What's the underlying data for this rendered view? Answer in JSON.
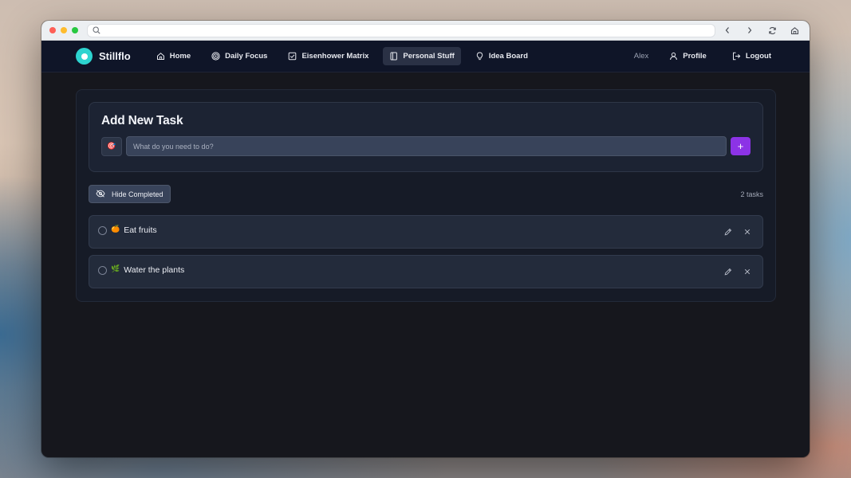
{
  "browser": {
    "url": "",
    "buttons": {
      "back": "chevron-left-icon",
      "forward": "chevron-right-icon",
      "reload": "reload-icon",
      "home": "home-icon"
    }
  },
  "brand": {
    "name": "Stillflo",
    "color": "#2dd4d0"
  },
  "nav": {
    "items": [
      {
        "label": "Home",
        "icon": "home-icon"
      },
      {
        "label": "Daily Focus",
        "icon": "target-icon"
      },
      {
        "label": "Eisenhower Matrix",
        "icon": "checkbox-icon"
      },
      {
        "label": "Personal Stuff",
        "icon": "notebook-icon",
        "active": true
      },
      {
        "label": "Idea Board",
        "icon": "lightbulb-icon"
      }
    ],
    "user": "Alex",
    "profile_label": "Profile",
    "logout_label": "Logout"
  },
  "add_task": {
    "title": "Add New Task",
    "emoji": "🎯",
    "placeholder": "What do you need to do?",
    "add_symbol": "+",
    "accent": "#8c33e6"
  },
  "toolbar": {
    "hide_completed_label": "Hide Completed",
    "task_count": "2 tasks"
  },
  "tasks": [
    {
      "emoji": "🍊",
      "text": "Eat fruits",
      "done": false
    },
    {
      "emoji": "🌿",
      "text": "Water the plants",
      "done": false
    }
  ]
}
